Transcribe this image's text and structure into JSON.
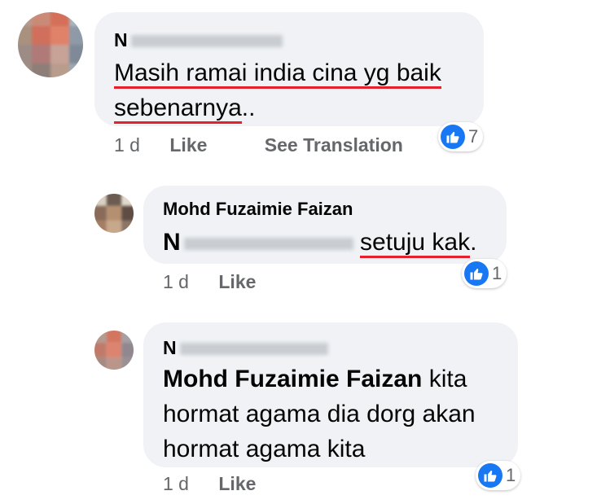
{
  "comments": [
    {
      "author_initial": "N",
      "body_segments": [
        "Masih ramai india cina yg baik",
        "sebenarnya",
        ".."
      ],
      "time": "1 d",
      "like_label": "Like",
      "translate_label": "See Translation",
      "reaction_count": "7",
      "reaction_icon": "thumbs-up-icon"
    },
    {
      "author": "Mohd Fuzaimie Faizan",
      "mention_initial": "N",
      "body": "setuju kak",
      "body_tail": ".",
      "time": "1 d",
      "like_label": "Like",
      "reaction_count": "1",
      "reaction_icon": "thumbs-up-icon"
    },
    {
      "author_initial": "N",
      "mention": "Mohd Fuzaimie Faizan",
      "body_lines": [
        "kita",
        "hormat agama dia dorg akan",
        "hormat agama kita"
      ],
      "time": "1 d",
      "like_label": "Like",
      "reaction_count": "1",
      "reaction_icon": "thumbs-up-icon"
    }
  ],
  "colors": {
    "bubble": "#f0f2f5",
    "meta": "#65676b",
    "like_blue": "#1877f2",
    "underline": "#e4202a"
  }
}
